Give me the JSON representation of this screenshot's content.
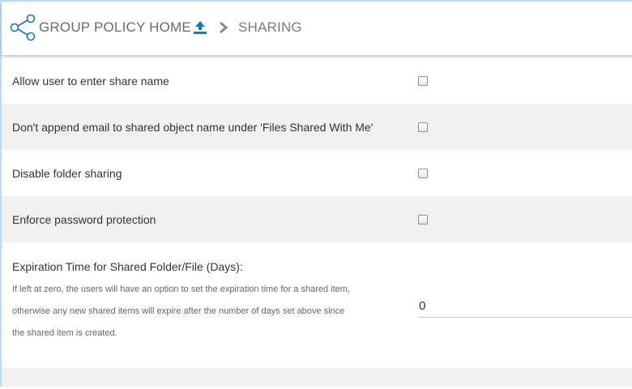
{
  "header": {
    "home_label": "GROUP POLICY HOME",
    "current_label": "SHARING",
    "accent_color": "#1b75bc",
    "share_icon": "share-icon",
    "upload_icon": "upload-icon",
    "separator_icon": "chevron-right-icon"
  },
  "settings": [
    {
      "label": "Allow user to enter share name",
      "checked": false
    },
    {
      "label": "Don't append email to shared object name under 'Files Shared With Me'",
      "checked": false
    },
    {
      "label": "Disable folder sharing",
      "checked": false
    },
    {
      "label": "Enforce password protection",
      "checked": false
    }
  ],
  "expiration": {
    "title": "Expiration Time for Shared Folder/File (Days):",
    "help_line1": "If left at zero, the users will have an option to set the expiration time for a shared item,",
    "help_line2": "otherwise any new shared items will expire after the number of days set above since",
    "help_line3": "the shared item is created.",
    "value": "0"
  }
}
